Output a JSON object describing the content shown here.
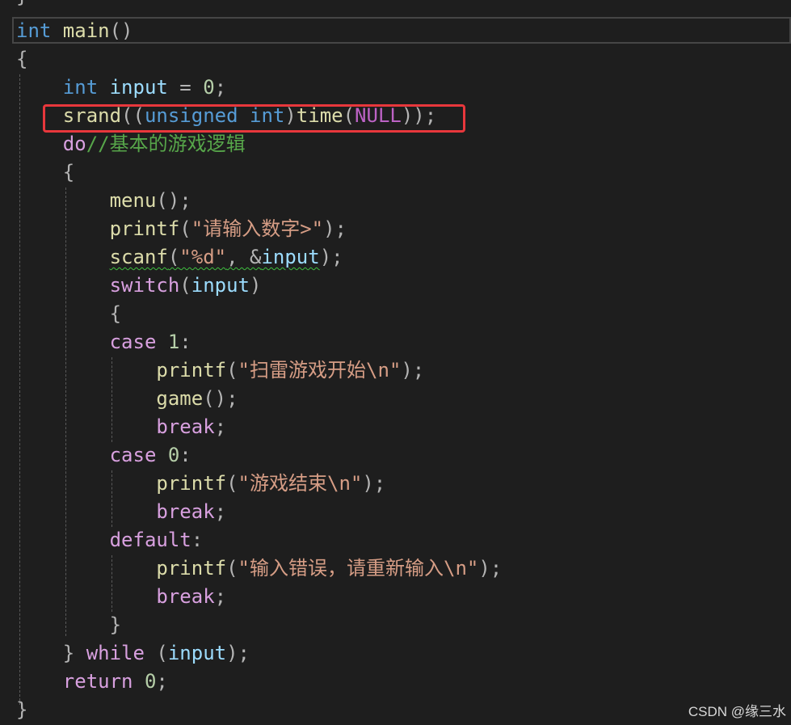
{
  "editor": {
    "top_fragment": "}",
    "lines": [
      {
        "id": "main-signature",
        "tokens": [
          {
            "t": "int",
            "c": "kw"
          },
          {
            "t": " main",
            "c": "fn"
          },
          {
            "t": "()",
            "c": "pun"
          }
        ]
      },
      {
        "id": "main-open-brace",
        "tokens": [
          {
            "t": "{",
            "c": "pun"
          }
        ]
      },
      {
        "id": "declare-input",
        "tokens": [
          {
            "t": "    "
          },
          {
            "t": "int",
            "c": "kw"
          },
          {
            "t": " input",
            "c": "var"
          },
          {
            "t": " = ",
            "c": "pun"
          },
          {
            "t": "0",
            "c": "num"
          },
          {
            "t": ";",
            "c": "pun"
          }
        ]
      },
      {
        "id": "srand-call",
        "tokens": [
          {
            "t": "    "
          },
          {
            "t": "srand",
            "c": "fn"
          },
          {
            "t": "((",
            "c": "pun"
          },
          {
            "t": "unsigned int",
            "c": "kw"
          },
          {
            "t": ")",
            "c": "pun"
          },
          {
            "t": "time",
            "c": "fn"
          },
          {
            "t": "(",
            "c": "pun"
          },
          {
            "t": "NULL",
            "c": "mac"
          },
          {
            "t": "));",
            "c": "pun"
          }
        ]
      },
      {
        "id": "do-comment",
        "tokens": [
          {
            "t": "    "
          },
          {
            "t": "do",
            "c": "ctl"
          },
          {
            "t": "//基本的游戏逻辑",
            "c": "cmt"
          }
        ]
      },
      {
        "id": "do-open-brace",
        "tokens": [
          {
            "t": "    "
          },
          {
            "t": "{",
            "c": "pun"
          }
        ]
      },
      {
        "id": "menu-call",
        "tokens": [
          {
            "t": "        "
          },
          {
            "t": "menu",
            "c": "fn"
          },
          {
            "t": "();",
            "c": "pun"
          }
        ]
      },
      {
        "id": "printf-prompt",
        "tokens": [
          {
            "t": "        "
          },
          {
            "t": "printf",
            "c": "fn"
          },
          {
            "t": "(",
            "c": "pun"
          },
          {
            "t": "\"请输入数字>\"",
            "c": "str"
          },
          {
            "t": ");",
            "c": "pun"
          }
        ]
      },
      {
        "id": "scanf-call",
        "tokens": [
          {
            "t": "        "
          },
          {
            "t": "scanf",
            "c": "fn",
            "err": true
          },
          {
            "t": "(",
            "c": "pun",
            "err": true
          },
          {
            "t": "\"%d\"",
            "c": "str",
            "err": true
          },
          {
            "t": ", &",
            "c": "pun",
            "err": true
          },
          {
            "t": "input",
            "c": "var",
            "err": true
          },
          {
            "t": ");",
            "c": "pun"
          }
        ]
      },
      {
        "id": "switch-stmt",
        "tokens": [
          {
            "t": "        "
          },
          {
            "t": "switch",
            "c": "ctl"
          },
          {
            "t": "(",
            "c": "pun"
          },
          {
            "t": "input",
            "c": "var"
          },
          {
            "t": ")",
            "c": "pun"
          }
        ]
      },
      {
        "id": "switch-open-brace",
        "tokens": [
          {
            "t": "        "
          },
          {
            "t": "{",
            "c": "pun"
          }
        ]
      },
      {
        "id": "case-1",
        "tokens": [
          {
            "t": "        "
          },
          {
            "t": "case",
            "c": "ctl"
          },
          {
            "t": " 1",
            "c": "num"
          },
          {
            "t": ":",
            "c": "pun"
          }
        ]
      },
      {
        "id": "printf-start",
        "tokens": [
          {
            "t": "            "
          },
          {
            "t": "printf",
            "c": "fn"
          },
          {
            "t": "(",
            "c": "pun"
          },
          {
            "t": "\"扫雷游戏开始\\n\"",
            "c": "str"
          },
          {
            "t": ");",
            "c": "pun"
          }
        ]
      },
      {
        "id": "game-call",
        "tokens": [
          {
            "t": "            "
          },
          {
            "t": "game",
            "c": "fn"
          },
          {
            "t": "();",
            "c": "pun"
          }
        ]
      },
      {
        "id": "break-1",
        "tokens": [
          {
            "t": "            "
          },
          {
            "t": "break",
            "c": "ctl"
          },
          {
            "t": ";",
            "c": "pun"
          }
        ]
      },
      {
        "id": "case-0",
        "tokens": [
          {
            "t": "        "
          },
          {
            "t": "case",
            "c": "ctl"
          },
          {
            "t": " 0",
            "c": "num"
          },
          {
            "t": ":",
            "c": "pun"
          }
        ]
      },
      {
        "id": "printf-end",
        "tokens": [
          {
            "t": "            "
          },
          {
            "t": "printf",
            "c": "fn"
          },
          {
            "t": "(",
            "c": "pun"
          },
          {
            "t": "\"游戏结束\\n\"",
            "c": "str"
          },
          {
            "t": ");",
            "c": "pun"
          }
        ]
      },
      {
        "id": "break-2",
        "tokens": [
          {
            "t": "            "
          },
          {
            "t": "break",
            "c": "ctl"
          },
          {
            "t": ";",
            "c": "pun"
          }
        ]
      },
      {
        "id": "default-label",
        "tokens": [
          {
            "t": "        "
          },
          {
            "t": "default",
            "c": "ctl"
          },
          {
            "t": ":",
            "c": "pun"
          }
        ]
      },
      {
        "id": "printf-error",
        "tokens": [
          {
            "t": "            "
          },
          {
            "t": "printf",
            "c": "fn"
          },
          {
            "t": "(",
            "c": "pun"
          },
          {
            "t": "\"输入错误，请重新输入\\n\"",
            "c": "str"
          },
          {
            "t": ");",
            "c": "pun"
          }
        ]
      },
      {
        "id": "break-3",
        "tokens": [
          {
            "t": "            "
          },
          {
            "t": "break",
            "c": "ctl"
          },
          {
            "t": ";",
            "c": "pun"
          }
        ]
      },
      {
        "id": "switch-close-brace",
        "tokens": [
          {
            "t": "        "
          },
          {
            "t": "}",
            "c": "pun"
          }
        ]
      },
      {
        "id": "while-clause",
        "tokens": [
          {
            "t": "    "
          },
          {
            "t": "}",
            "c": "pun"
          },
          {
            "t": " while",
            "c": "ctl"
          },
          {
            "t": " (",
            "c": "pun"
          },
          {
            "t": "input",
            "c": "var"
          },
          {
            "t": ");",
            "c": "pun"
          }
        ]
      },
      {
        "id": "return-stmt",
        "tokens": [
          {
            "t": "    "
          },
          {
            "t": "return",
            "c": "ctl"
          },
          {
            "t": " 0",
            "c": "num"
          },
          {
            "t": ";",
            "c": "pun"
          }
        ]
      },
      {
        "id": "main-close-brace",
        "tokens": [
          {
            "t": "}",
            "c": "pun"
          }
        ]
      }
    ]
  },
  "watermark": "CSDN @缘三水",
  "colors": {
    "background": "#1e1e1e",
    "keyword": "#569cd6",
    "control": "#d8a0df",
    "function": "#dcdcaa",
    "variable": "#9cdcfe",
    "number": "#b5cea8",
    "string": "#d69d85",
    "comment": "#57a64a",
    "macro": "#bd63c5",
    "highlight_box": "#e8373c"
  }
}
